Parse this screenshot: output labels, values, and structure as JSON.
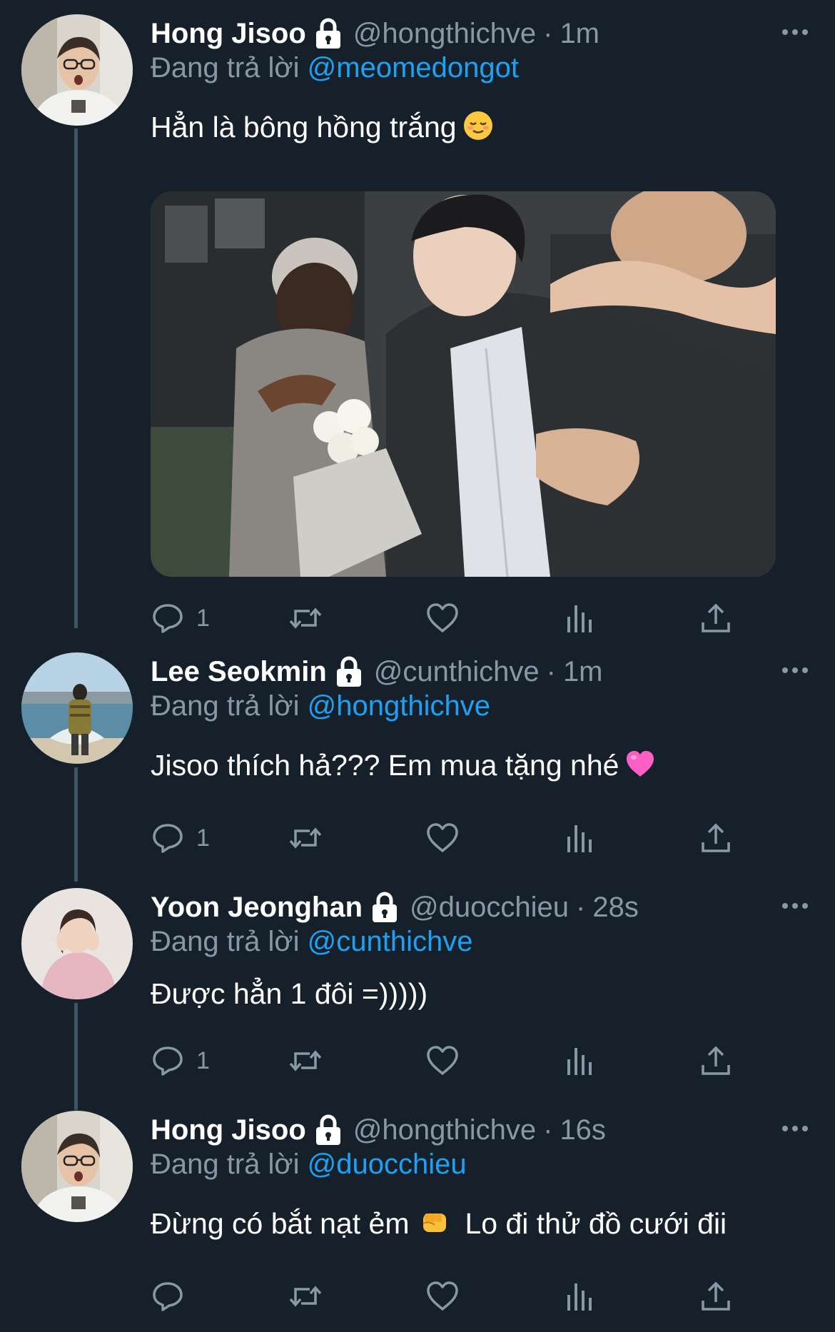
{
  "colors": {
    "background": "#15202b",
    "secondary_text": "#8899a6",
    "mention": "#1da1f2",
    "thread_line": "#3d5466"
  },
  "icons": {
    "reply": "speech-bubble-icon",
    "retweet": "retweet-icon",
    "like": "heart-icon",
    "stats": "bar-chart-icon",
    "share": "share-icon",
    "lock": "lock-icon",
    "more": "more-dots-icon"
  },
  "tweets": [
    {
      "name": "Hong Jisoo",
      "handle": "@hongthichve",
      "separator": "·",
      "time": "1m",
      "replying_prefix": "Đang trả lời",
      "replying_to": "@meomedongot",
      "text": "Hẳn là bông hồng trắng",
      "emoji": "relieved-face-emoji",
      "has_image": true,
      "reply_count": "1"
    },
    {
      "name": "Lee Seokmin",
      "handle": "@cunthichve",
      "separator": "·",
      "time": "1m",
      "replying_prefix": "Đang trả lời",
      "replying_to": "@hongthichve",
      "text": "Jisoo thích hả??? Em mua tặng nhé",
      "emoji": "pink-heart-emoji",
      "reply_count": "1"
    },
    {
      "name": "Yoon Jeonghan",
      "handle": "@duocchieu",
      "separator": "·",
      "time": "28s",
      "replying_prefix": "Đang trả lời",
      "replying_to": "@cunthichve",
      "text": "Được hẳn 1 đôi =)))))",
      "reply_count": "1"
    },
    {
      "name": "Hong Jisoo",
      "handle": "@hongthichve",
      "separator": "·",
      "time": "16s",
      "replying_prefix": "Đang trả lời",
      "replying_to": "@duocchieu",
      "text_before": "Đừng có bắt nạt ẻm",
      "emoji": "fist-emoji",
      "text_after": "Lo đi thử đồ cưới đii",
      "reply_count": ""
    }
  ]
}
